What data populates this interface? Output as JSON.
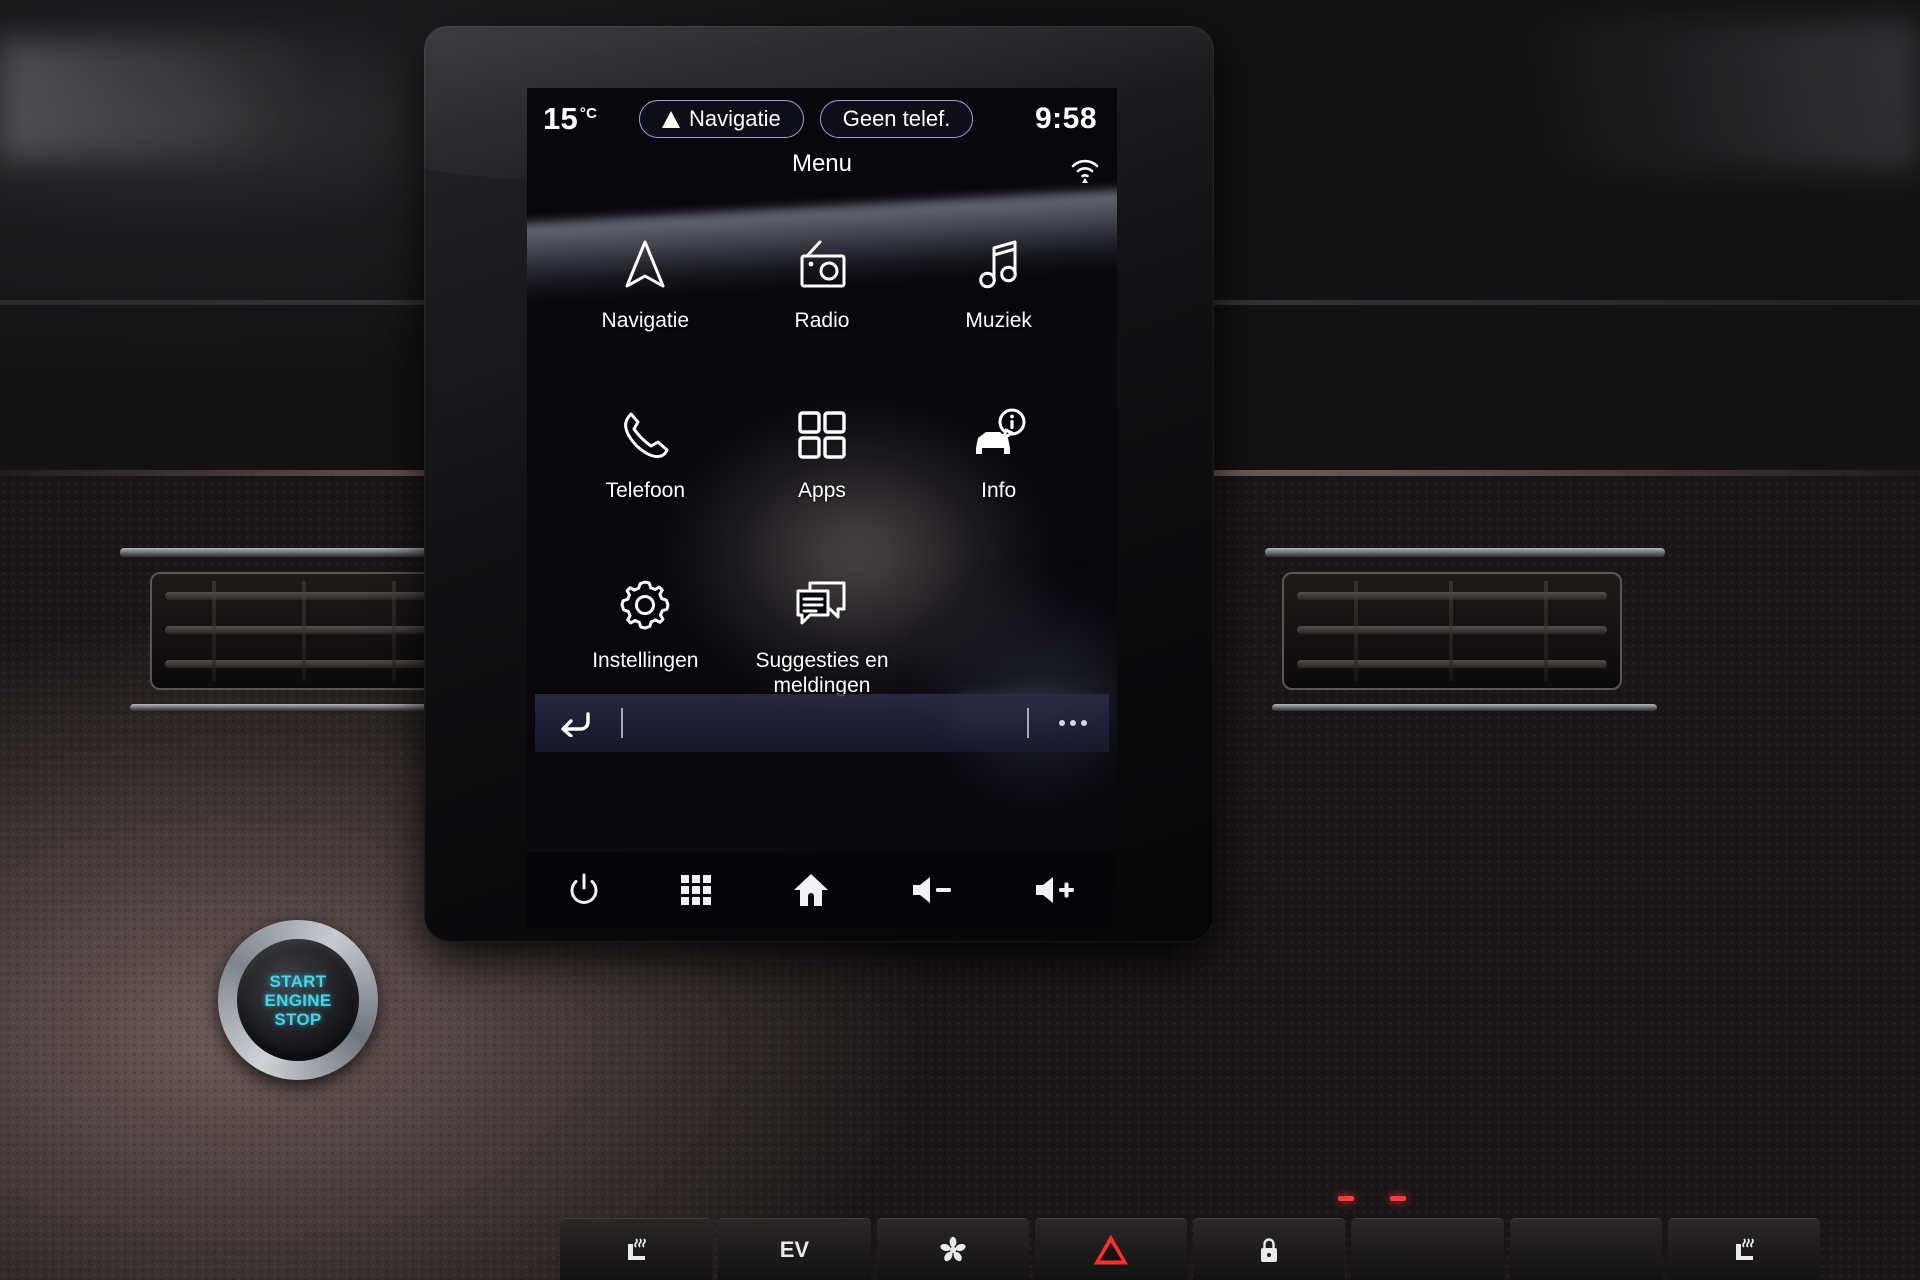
{
  "status_bar": {
    "temperature": "15",
    "temperature_unit": "°C",
    "nav_pill_label": "Navigatie",
    "phone_pill_label": "Geen telef.",
    "clock": "9:58",
    "wifi_icon": "wifi-broadcast-icon"
  },
  "screen": {
    "title": "Menu"
  },
  "menu": {
    "items": [
      {
        "id": "navigatie",
        "label": "Navigatie",
        "icon": "navigation-arrow-icon"
      },
      {
        "id": "radio",
        "label": "Radio",
        "icon": "radio-icon"
      },
      {
        "id": "muziek",
        "label": "Muziek",
        "icon": "music-note-icon"
      },
      {
        "id": "telefoon",
        "label": "Telefoon",
        "icon": "phone-handset-icon"
      },
      {
        "id": "apps",
        "label": "Apps",
        "icon": "grid-four-squares-icon"
      },
      {
        "id": "info",
        "label": "Info",
        "icon": "car-info-icon"
      },
      {
        "id": "instellingen",
        "label": "Instellingen",
        "icon": "gear-icon"
      },
      {
        "id": "suggesties",
        "label": "Suggesties en meldingen",
        "icon": "speech-bubbles-icon"
      }
    ]
  },
  "sub_bar": {
    "back_icon": "back-arrow-icon",
    "more_icon": "more-dots-icon"
  },
  "hardware_row": {
    "buttons": [
      {
        "id": "power",
        "icon": "power-icon"
      },
      {
        "id": "apps-grid",
        "icon": "grid-nine-squares-icon"
      },
      {
        "id": "home",
        "icon": "home-icon"
      },
      {
        "id": "volume-down",
        "icon": "volume-down-icon"
      },
      {
        "id": "volume-up",
        "icon": "volume-up-icon"
      }
    ]
  },
  "start_button": {
    "line1": "START",
    "line2": "ENGINE",
    "line3": "STOP"
  },
  "console_buttons": [
    {
      "id": "seat-heater-left",
      "label": "",
      "icon": "heated-seat-icon"
    },
    {
      "id": "ev-mode",
      "label": "EV",
      "icon": ""
    },
    {
      "id": "climate-fan",
      "label": "",
      "icon": "fan-icon"
    },
    {
      "id": "hazard",
      "label": "",
      "icon": "hazard-triangle-icon"
    },
    {
      "id": "central-lock",
      "label": "",
      "icon": "lock-icon"
    },
    {
      "id": "blank-1",
      "label": "",
      "icon": ""
    },
    {
      "id": "blank-2",
      "label": "",
      "icon": ""
    },
    {
      "id": "seat-heater-right",
      "label": "",
      "icon": "heated-seat-icon"
    }
  ],
  "colors": {
    "accent_pill_border": "#a79ede",
    "screen_bg": "#07070c",
    "text": "#ffffff",
    "hazard_red": "#ff2d2d",
    "start_cyan": "#47d3e8"
  }
}
